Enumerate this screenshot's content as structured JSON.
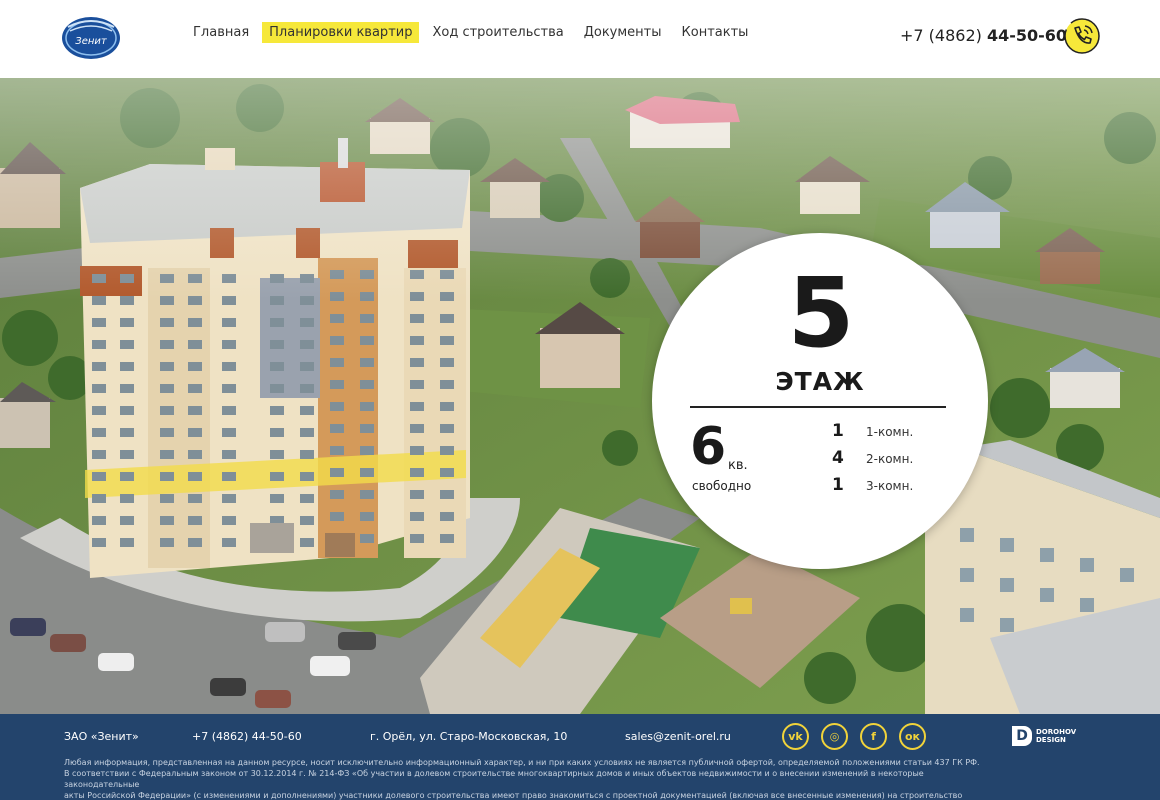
{
  "header": {
    "logo_text": "Зенит",
    "nav": [
      {
        "label": "Главная",
        "active": false
      },
      {
        "label": "Планировки квартир",
        "active": true
      },
      {
        "label": "Ход строительства",
        "active": false
      },
      {
        "label": "Документы",
        "active": false
      },
      {
        "label": "Контакты",
        "active": false
      }
    ],
    "phone_prefix": "+7 (4862)",
    "phone_number": "44-50-60",
    "call_icon": "phone-call-icon"
  },
  "floor_info": {
    "floor_number": "5",
    "floor_label": "ЭТАЖ",
    "free_count": "6",
    "free_unit": "кв.",
    "free_label": "свободно",
    "rooms": [
      {
        "count": "1",
        "type": "1-комн."
      },
      {
        "count": "4",
        "type": "2-комн."
      },
      {
        "count": "1",
        "type": "3-комн."
      }
    ]
  },
  "footer": {
    "company": "ЗАО «Зенит»",
    "phone": "+7 (4862) 44-50-60",
    "address": "г. Орёл, ул. Старо-Московская, 10",
    "email": "sales@zenit-orel.ru",
    "social": [
      {
        "name": "vk-icon",
        "glyph": "vk"
      },
      {
        "name": "instagram-icon",
        "glyph": "◎"
      },
      {
        "name": "facebook-icon",
        "glyph": "f"
      },
      {
        "name": "odnoklassniki-icon",
        "glyph": "ок"
      }
    ],
    "developer_mark": "D",
    "developer_line1": "DOROHOV",
    "developer_line2": "DESIGN",
    "legal_line1": "Любая информация, представленная на данном ресурсе, носит исключительно информационный характер, и ни при каких условиях не является публичной офертой, определяемой положениями статьи 437 ГК РФ.",
    "legal_line2": "В соответствии с Федеральным законом от 30.12.2014 г. № 214-ФЗ «Об участии в долевом строительстве многоквартирных домов и иных объектов недвижимости и о внесении изменений в некоторые законодательные",
    "legal_line3": "акты Российской Федерации» (с изменениями и дополнениями) участники долевого строительства имеют право знакомиться с проектной документацией (включая все внесенные изменения) на строительство объекта."
  },
  "colors": {
    "accent_yellow": "#f6e83a",
    "footer_bg": "#23446c",
    "social_yellow": "#f1d33a"
  }
}
